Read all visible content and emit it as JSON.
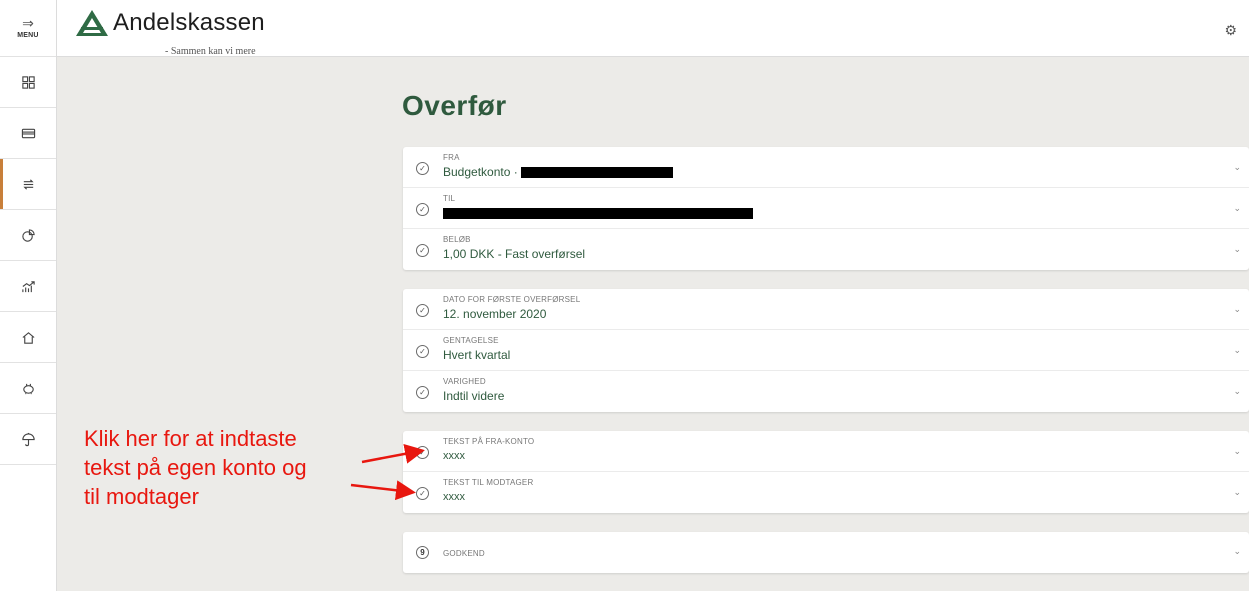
{
  "sidebar": {
    "menu_label": "MENU",
    "items": [
      {
        "icon": "dashboard-icon"
      },
      {
        "icon": "card-icon"
      },
      {
        "icon": "transfer-icon",
        "active": true
      },
      {
        "icon": "pie-chart-icon"
      },
      {
        "icon": "growth-chart-icon"
      },
      {
        "icon": "home-icon"
      },
      {
        "icon": "piggy-bank-icon"
      },
      {
        "icon": "umbrella-icon"
      }
    ]
  },
  "header": {
    "brand": "Andelskassen",
    "tagline": "- Sammen kan vi mere",
    "settings_icon": "gear-icon"
  },
  "page": {
    "title": "Overfør"
  },
  "card1": {
    "fra_label": "FRA",
    "fra_value": "Budgetkonto  ·",
    "til_label": "TIL",
    "belob_label": "BELØB",
    "belob_value": "1,00 DKK - Fast overførsel"
  },
  "card2": {
    "dato_label": "DATO FOR FØRSTE OVERFØRSEL",
    "dato_value": "12. november 2020",
    "gentagelse_label": "GENTAGELSE",
    "gentagelse_value": "Hvert kvartal",
    "varighed_label": "VARIGHED",
    "varighed_value": "Indtil videre"
  },
  "card3": {
    "tekst_fra_label": "TEKST PÅ FRA-KONTO",
    "tekst_fra_value": "xxxx",
    "tekst_til_label": "TEKST TIL MODTAGER",
    "tekst_til_value": "xxxx"
  },
  "card4": {
    "step_number": "9",
    "godkend_label": "GODKEND"
  },
  "annotation": {
    "line1": "Klik her for at indtaste",
    "line2": "tekst på egen konto og",
    "line3": "til modtager",
    "color": "#e8170f"
  },
  "colors": {
    "accent_green": "#2f5a3e",
    "active_marker": "#c87f3a",
    "background": "#ecebe8"
  }
}
